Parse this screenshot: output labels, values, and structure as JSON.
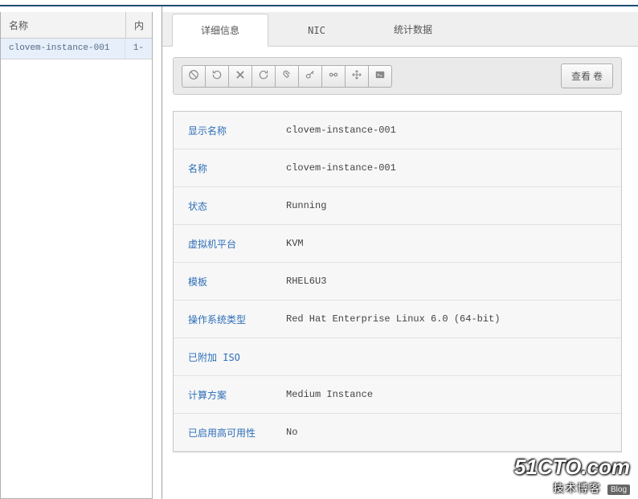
{
  "left": {
    "header": {
      "name": "名称",
      "inner": "内"
    },
    "rows": [
      {
        "name": "clovem-instance-001",
        "inner": "1-"
      }
    ]
  },
  "tabs": {
    "detail": "详细信息",
    "nic": "NIC",
    "stats": "统计数据"
  },
  "toolbar": {
    "view_volumes": "查看 卷",
    "icons": {
      "stop": "stop-icon",
      "restart": "restart-icon",
      "delete": "delete-icon",
      "refresh": "refresh-icon",
      "attach": "attach-icon",
      "reset-pw": "reset-pw-icon",
      "link": "link-icon",
      "migrate": "migrate-icon",
      "console": "console-icon"
    }
  },
  "detail": {
    "rows": [
      {
        "label": "显示名称",
        "value": "clovem-instance-001"
      },
      {
        "label": "名称",
        "value": "clovem-instance-001"
      },
      {
        "label": "状态",
        "value": "Running"
      },
      {
        "label": "虚拟机平台",
        "value": "KVM"
      },
      {
        "label": "模板",
        "value": "RHEL6U3"
      },
      {
        "label": "操作系统类型",
        "value": "Red Hat Enterprise Linux 6.0 (64-bit)"
      },
      {
        "label": "已附加 ISO",
        "value": ""
      },
      {
        "label": "计算方案",
        "value": "Medium Instance"
      },
      {
        "label": "已启用高可用性",
        "value": "No"
      }
    ]
  },
  "watermark": {
    "big": "51CTO.com",
    "small": "技术博客",
    "blog": "Blog"
  }
}
